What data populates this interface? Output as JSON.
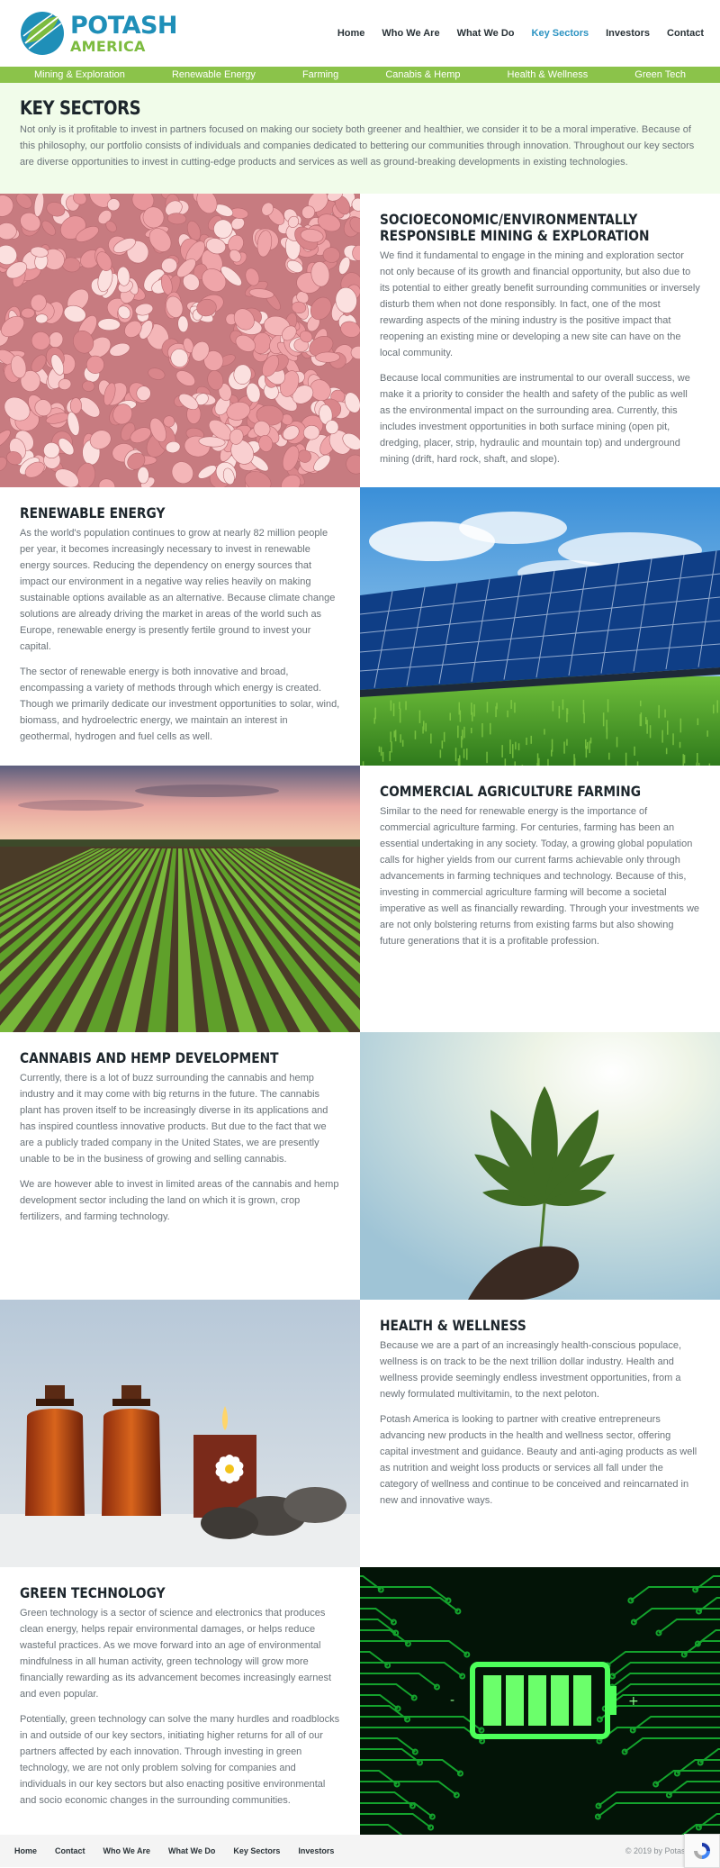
{
  "brand": {
    "name": "POTASH",
    "sub": "AMERICA"
  },
  "nav": [
    {
      "label": "Home",
      "active": false
    },
    {
      "label": "Who We Are",
      "active": false
    },
    {
      "label": "What We Do",
      "active": false
    },
    {
      "label": "Key Sectors",
      "active": true
    },
    {
      "label": "Investors",
      "active": false
    },
    {
      "label": "Contact",
      "active": false
    }
  ],
  "sector_tabs": [
    "Mining & Exploration",
    "Renewable Energy",
    "Farming",
    "Canabis & Hemp",
    "Health & Wellness",
    "Green Tech"
  ],
  "intro": {
    "title": "KEY SECTORS",
    "text": "Not only is it profitable to invest in partners focused on making our society both greener and healthier, we consider it to be a moral imperative. Because of this philosophy, our portfolio consists of individuals and companies dedicated to bettering our communities through innovation. Throughout our key sectors are diverse opportunities to invest in cutting-edge products and services as well as ground-breaking developments in existing technologies."
  },
  "sections": [
    {
      "title": "SOCIOECONOMIC/ENVIRONMENTALLY RESPONSIBLE MINING & EXPLORATION",
      "image": "pink-potash-gravel",
      "paragraphs": [
        "We find it fundamental to engage in the mining and exploration sector not only because of its growth and financial opportunity, but also due to its potential to either greatly benefit surrounding communities or inversely disturb them when not done responsibly. In fact, one of the most rewarding aspects of the mining industry is the positive impact that reopening an existing mine or developing a new site can have on the local community.",
        "Because local communities are instrumental to our overall success, we make it a priority to consider the health and safety of the public as well as the environmental impact on the surrounding area. Currently, this includes investment opportunities in both surface mining (open pit, dredging, placer, strip, hydraulic and mountain top) and underground mining (drift, hard rock, shaft, and slope)."
      ]
    },
    {
      "title": "RENEWABLE ENERGY",
      "image": "solar-panels-field",
      "paragraphs": [
        "As the world's population continues to grow at nearly 82 million people per year, it becomes increasingly necessary to invest in renewable energy sources. Reducing the dependency on energy sources that impact our environment in a negative way relies heavily on making sustainable options available as an alternative. Because climate change solutions are already driving the market in areas of the world such as Europe, renewable energy is presently fertile ground to invest your capital.",
        "The sector of renewable energy is both innovative and broad, encompassing a variety of methods through which energy is created. Though we primarily dedicate our investment opportunities to solar, wind, biomass, and hydroelectric energy, we maintain an interest in geothermal, hydrogen and fuel cells as well."
      ]
    },
    {
      "title": "COMMERCIAL AGRICULTURE FARMING",
      "image": "crop-rows-sunset",
      "paragraphs": [
        "Similar to the need for renewable energy is the importance of commercial agriculture farming. For centuries, farming has been an essential undertaking in any society. Today, a growing global population calls for higher yields from our current farms achievable only through advancements in farming techniques and technology. Because of this, investing in commercial agriculture farming will become a societal imperative as well as financially rewarding. Through your investments we are not only bolstering returns from existing farms but also showing future generations that it is a profitable profession."
      ]
    },
    {
      "title": "CANNABIS AND HEMP DEVELOPMENT",
      "image": "hemp-leaf-sky",
      "paragraphs": [
        "Currently, there is a lot of buzz surrounding the cannabis and hemp industry and it may come with big returns in the future. The cannabis plant has proven itself to be increasingly diverse in its applications and has inspired countless innovative products. But due to the fact that we are a publicly traded company in the United States, we are presently unable to be in the business of growing and selling cannabis.",
        "We are however able to invest in limited areas of the cannabis and hemp development sector including the land on which it is grown, crop fertilizers, and farming technology."
      ]
    },
    {
      "title": "HEALTH & WELLNESS",
      "image": "oil-bottles-candle-stones",
      "paragraphs": [
        "Because we are a part of an increasingly health-conscious populace, wellness is on track to be the next trillion dollar industry. Health and wellness provide seemingly endless investment opportunities, from a newly formulated multivitamin, to the next peloton.",
        "Potash America is looking to partner with creative entrepreneurs advancing new products in the health and wellness sector, offering capital investment and guidance. Beauty and anti-aging products as well as nutrition and weight loss products or services all fall under the category of wellness and continue to be conceived and reincarnated in new and innovative ways."
      ]
    },
    {
      "title": "GREEN TECHNOLOGY",
      "image": "green-circuit-battery",
      "paragraphs": [
        "Green technology is a sector of science and electronics that produces clean energy, helps repair environmental damages, or helps reduce wasteful practices. As we move forward into an age of environmental mindfulness in all human activity, green technology will grow more financially rewarding as its advancement becomes increasingly earnest and even popular.",
        "Potentially, green technology can solve the many hurdles and roadblocks in and outside of our key sectors, initiating higher returns for all of our partners affected by each innovation. Through investing in green technology, we are not only problem solving for companies and individuals in our key sectors but also enacting positive environmental and socio economic changes in the surrounding communities."
      ]
    }
  ],
  "footer": {
    "links": [
      "Home",
      "Contact",
      "Who We Are",
      "What We Do",
      "Key Sectors",
      "Investors"
    ],
    "copyright": "© 2019 by Potash Am"
  },
  "colors": {
    "brand_blue": "#1f8fb8",
    "brand_green": "#7cbb3f",
    "bar_green": "#8bc34a",
    "intro_bg": "#f1fcea",
    "active_link": "#2c93c2"
  }
}
